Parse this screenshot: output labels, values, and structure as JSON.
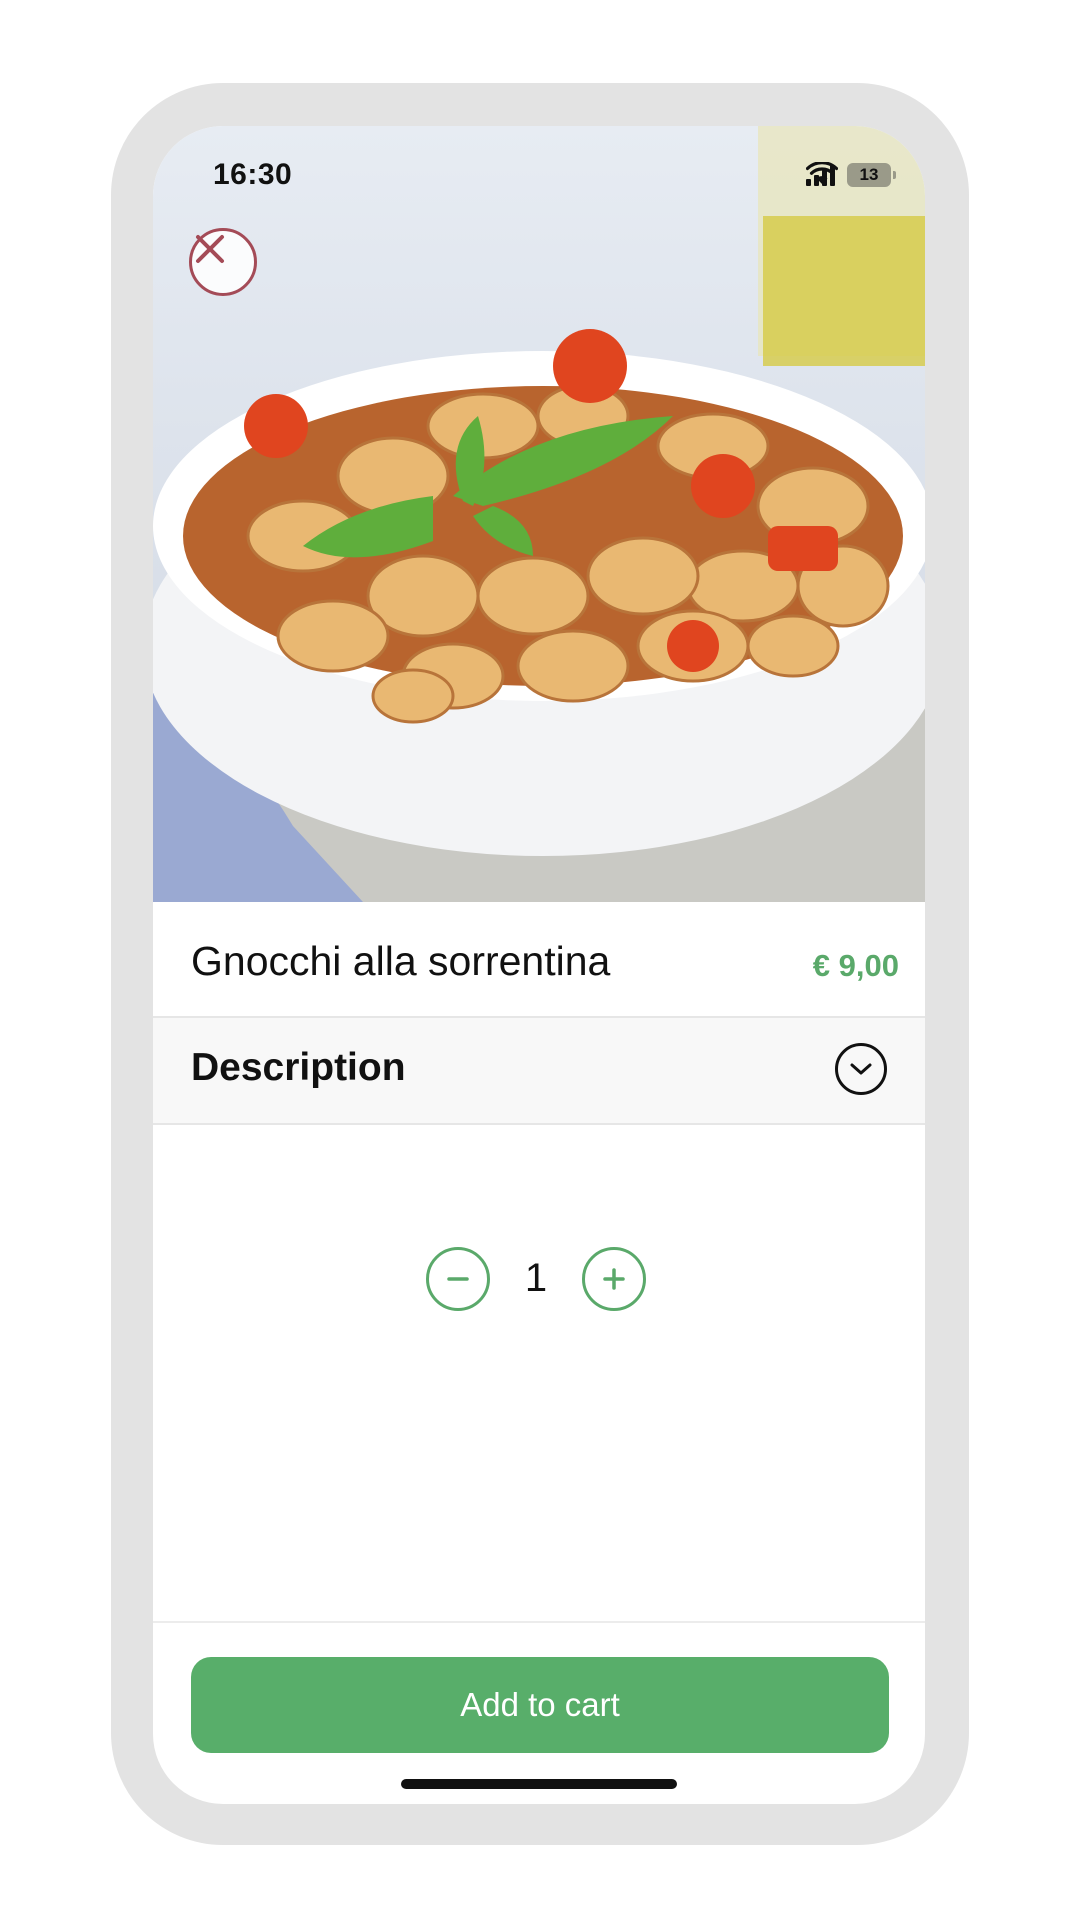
{
  "status_bar": {
    "time": "16:30",
    "battery_level": "13",
    "icons": [
      "signal-icon",
      "wifi-icon",
      "battery-icon"
    ]
  },
  "hero": {
    "image_subject": "pasta-bowl-image",
    "close_icon": "close-icon"
  },
  "product": {
    "name": "Gnocchi alla sorrentina",
    "price": "€ 9,00"
  },
  "description": {
    "label": "Description",
    "expand_icon": "chevron-down-icon"
  },
  "quantity": {
    "value": "1",
    "decrement_icon": "minus-icon",
    "increment_icon": "plus-icon"
  },
  "cart": {
    "add_label": "Add to cart"
  },
  "colors": {
    "accent": "#58ae6a",
    "price": "#5aa96a",
    "close": "#a44b57",
    "device_frame": "#e3e3e3"
  }
}
